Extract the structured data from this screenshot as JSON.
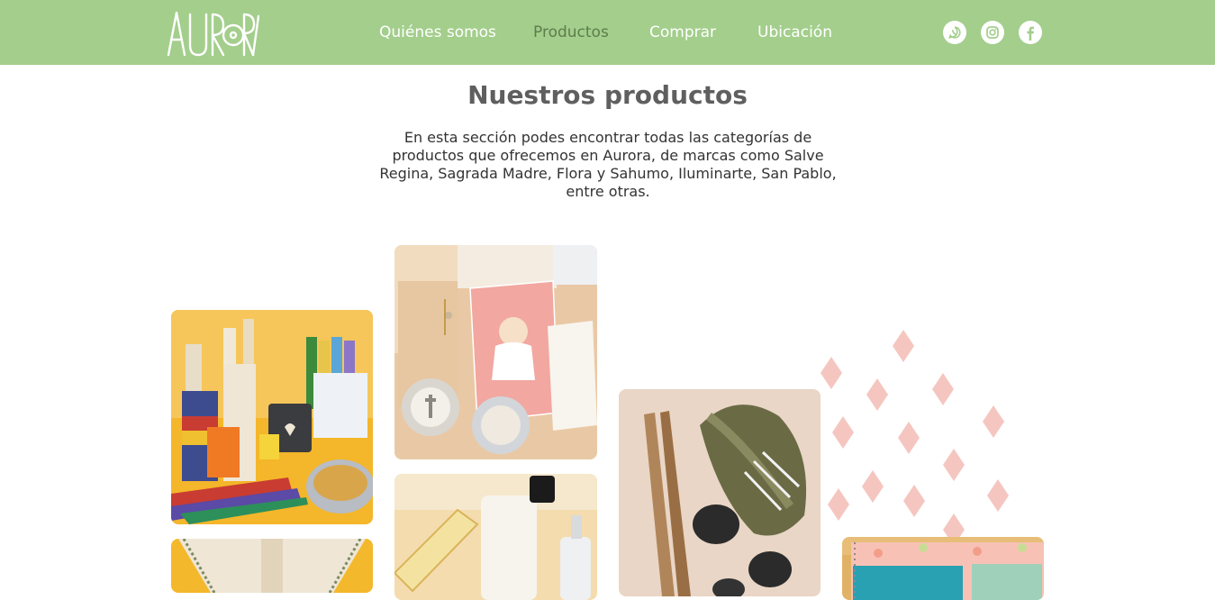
{
  "header": {
    "logo_text": "AURORA",
    "nav": [
      {
        "label": "Quiénes somos",
        "active": false
      },
      {
        "label": "Productos",
        "active": true
      },
      {
        "label": "Comprar",
        "active": false
      },
      {
        "label": "Ubicación",
        "active": false
      }
    ],
    "social_icons": [
      "whatsapp-icon",
      "instagram-icon",
      "facebook-icon"
    ]
  },
  "main": {
    "title": "Nuestros productos",
    "intro": "En esta sección podes encontrar todas las categorías de productos que ofrecemos en Aurora, de marcas como Salve Regina, Sagrada Madre, Flora y Sahumo, Iluminarte, San Pablo, entre otras."
  },
  "colors": {
    "header_bg": "#a3ce8c",
    "nav_active": "#5e7d4c",
    "decor_diamond": "#f5c6c0"
  },
  "products": [
    {
      "name": "candles-image",
      "colors": [
        "#f4b62a",
        "#e7d9c0",
        "#c93c32",
        "#5b4aa6"
      ]
    },
    {
      "name": "communion-cards-image",
      "colors": [
        "#efd3b3",
        "#f2a7a0",
        "#ffffff",
        "#c9b69b"
      ]
    },
    {
      "name": "incense-sage-image",
      "colors": [
        "#e6d2c2",
        "#6a6b45",
        "#2b2b2b",
        "#b0855a"
      ]
    },
    {
      "name": "candle-holder-image",
      "colors": [
        "#f4b82c",
        "#efe6d6",
        "#9aa07e",
        "#d8c5a9"
      ]
    },
    {
      "name": "aroma-spray-image",
      "colors": [
        "#f2d29a",
        "#f7f4ee",
        "#1b1b1b",
        "#e6b070"
      ]
    },
    {
      "name": "notebooks-image",
      "colors": [
        "#f7c2b5",
        "#2aa0b3",
        "#e1b266",
        "#c9dc94"
      ]
    }
  ]
}
